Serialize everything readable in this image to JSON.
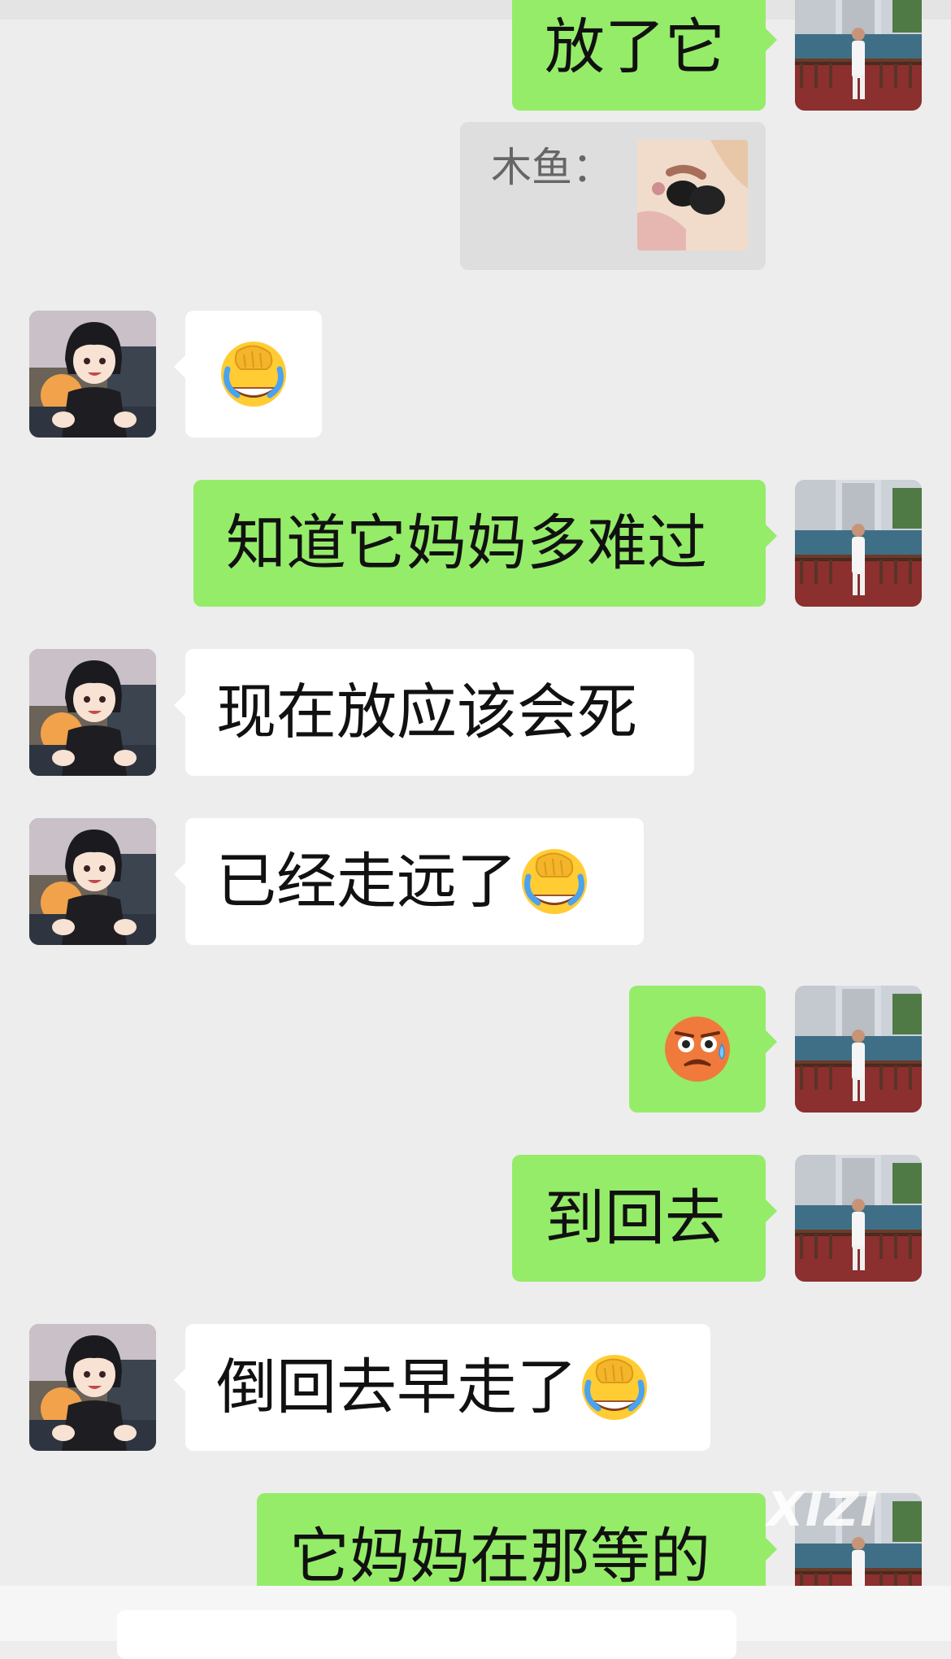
{
  "quote": {
    "label": "木鱼："
  },
  "messages": [
    {
      "id": "m1",
      "side": "out",
      "text": "放了它"
    },
    {
      "id": "m2",
      "side": "in",
      "text": "",
      "emoji": "facepalm-laughing-emoji"
    },
    {
      "id": "m3",
      "side": "out",
      "text": "知道它妈妈多难过"
    },
    {
      "id": "m4",
      "side": "in",
      "text": "现在放应该会死"
    },
    {
      "id": "m5",
      "side": "in",
      "text": "已经走远了",
      "emoji": "facepalm-laughing-emoji"
    },
    {
      "id": "m6",
      "side": "out",
      "text": "",
      "emoji": "sweating-awkward-emoji"
    },
    {
      "id": "m7",
      "side": "out",
      "text": "到回去"
    },
    {
      "id": "m8",
      "side": "in",
      "text": "倒回去早走了",
      "emoji": "facepalm-laughing-emoji"
    },
    {
      "id": "m9",
      "side": "out",
      "text": "它妈妈在那等的"
    }
  ],
  "watermark": "XIZI",
  "colors": {
    "background": "#ededed",
    "outgoing": "#95ec69",
    "incoming": "#ffffff",
    "quote": "#dedede"
  }
}
